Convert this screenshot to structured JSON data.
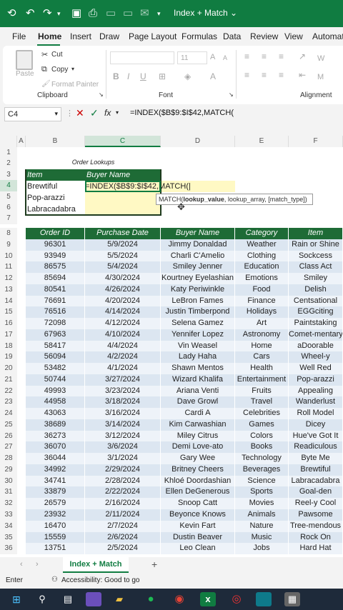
{
  "title_bar": {
    "title": "Index + Match ⌄"
  },
  "menu": [
    "File",
    "Home",
    "Insert",
    "Draw",
    "Page Layout",
    "Formulas",
    "Data",
    "Review",
    "View",
    "Automate"
  ],
  "ribbon": {
    "paste": "Paste",
    "cut": "Cut",
    "copy": "Copy",
    "format_painter": "Format Painter",
    "clipboard": "Clipboard",
    "font": "Font",
    "font_size": "11",
    "alignment": "Alignment",
    "wrap_fragment": "W",
    "merge_fragment": "M"
  },
  "formula_bar": {
    "name_box": "C4",
    "fx": "fx",
    "formula": "=INDEX($B$9:$I$42,MATCH("
  },
  "columns": [
    "A",
    "B",
    "C",
    "D",
    "E",
    "F"
  ],
  "rows": [
    "1",
    "2",
    "3",
    "4",
    "5",
    "6",
    "7",
    "8",
    "9",
    "10",
    "11",
    "12",
    "13",
    "14",
    "15",
    "16",
    "17",
    "18",
    "19",
    "20",
    "21",
    "22",
    "23",
    "24",
    "25",
    "26",
    "27",
    "28",
    "29",
    "30",
    "31",
    "32",
    "33",
    "34",
    "35",
    "36"
  ],
  "lookup_table": {
    "title": "Order Lookups",
    "headers": [
      "Item",
      "Buyer Name"
    ],
    "items": [
      "Brewtiful",
      "Pop-arazzi",
      "Labracadabra"
    ],
    "editing_value": "=INDEX($B$9:$I$42,MATCH(|"
  },
  "tooltip": {
    "fn": "MATCH(",
    "arg1": "lookup_value",
    "rest": ", lookup_array, [match_type])"
  },
  "main_table": {
    "headers": [
      "Order ID",
      "Purchase Date",
      "Buyer Name",
      "Category",
      "Item"
    ],
    "rows": [
      [
        "96301",
        "5/9/2024",
        "Jimmy Donaldad",
        "Weather",
        "Rain or Shine"
      ],
      [
        "93949",
        "5/5/2024",
        "Charli C'Amelio",
        "Clothing",
        "Sockcess"
      ],
      [
        "86575",
        "5/4/2024",
        "Smiley Jenner",
        "Education",
        "Class Act"
      ],
      [
        "85694",
        "4/30/2024",
        "Kourtney Eyelashian",
        "Emotions",
        "Smiley"
      ],
      [
        "80541",
        "4/26/2024",
        "Katy Periwinkle",
        "Food",
        "Delish"
      ],
      [
        "76691",
        "4/20/2024",
        "LeBron Fames",
        "Finance",
        "Centsational"
      ],
      [
        "76516",
        "4/14/2024",
        "Justin Timberpond",
        "Holidays",
        "EGGciting"
      ],
      [
        "72098",
        "4/12/2024",
        "Selena Gamez",
        "Art",
        "Paintstaking"
      ],
      [
        "67963",
        "4/10/2024",
        "Yennifer Lopez",
        "Astronomy",
        "Comet-mentary"
      ],
      [
        "58417",
        "4/4/2024",
        "Vin Weasel",
        "Home",
        "aDoorable"
      ],
      [
        "56094",
        "4/2/2024",
        "Lady Haha",
        "Cars",
        "Wheel-y"
      ],
      [
        "53482",
        "4/1/2024",
        "Shawn Mentos",
        "Health",
        "Well Red"
      ],
      [
        "50744",
        "3/27/2024",
        "Wizard Khalifa",
        "Entertainment",
        "Pop-arazzi"
      ],
      [
        "49993",
        "3/23/2024",
        "Ariana Venti",
        "Fruits",
        "Appealing"
      ],
      [
        "44958",
        "3/18/2024",
        "Dave Growl",
        "Travel",
        "Wanderlust"
      ],
      [
        "43063",
        "3/16/2024",
        "Cardi A",
        "Celebrities",
        "Roll Model"
      ],
      [
        "38689",
        "3/14/2024",
        "Kim Carwashian",
        "Games",
        "Dicey"
      ],
      [
        "36273",
        "3/12/2024",
        "Miley Citrus",
        "Colors",
        "Hue've Got It"
      ],
      [
        "36070",
        "3/6/2024",
        "Demi Love-ato",
        "Books",
        "Readiculous"
      ],
      [
        "36044",
        "3/1/2024",
        "Gary Wee",
        "Technology",
        "Byte Me"
      ],
      [
        "34992",
        "2/29/2024",
        "Britney Cheers",
        "Beverages",
        "Brewtiful"
      ],
      [
        "34741",
        "2/28/2024",
        "Khloé Doordashian",
        "Science",
        "Labracadabra"
      ],
      [
        "33879",
        "2/22/2024",
        "Ellen DeGenerous",
        "Sports",
        "Goal-den"
      ],
      [
        "26579",
        "2/16/2024",
        "Snoop Catt",
        "Movies",
        "Reel-y Cool"
      ],
      [
        "23932",
        "2/11/2024",
        "Beyonce Knows",
        "Animals",
        "Pawsome"
      ],
      [
        "16470",
        "2/7/2024",
        "Kevin Fart",
        "Nature",
        "Tree-mendous"
      ],
      [
        "15559",
        "2/6/2024",
        "Dustin Beaver",
        "Music",
        "Rock On"
      ],
      [
        "13751",
        "2/5/2024",
        "Leo Clean",
        "Jobs",
        "Hard Hat"
      ]
    ]
  },
  "sheet_tab": "Index + Match",
  "status": {
    "mode": "Enter",
    "accessibility": "Accessibility: Good to go"
  },
  "colors": {
    "excel_green": "#107c41",
    "header_green": "#1e6b36",
    "band": "#dce6f1"
  }
}
